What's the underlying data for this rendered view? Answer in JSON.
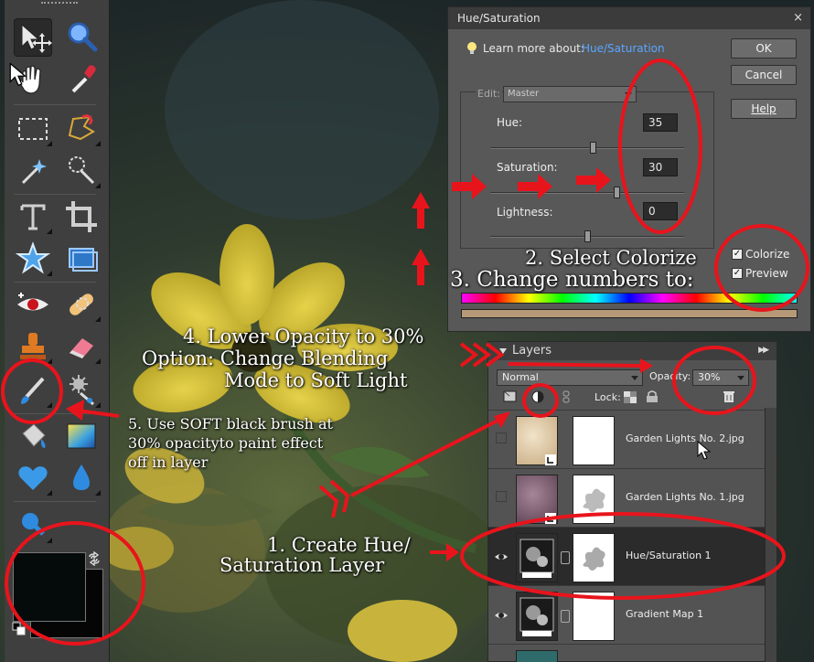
{
  "colors": {
    "annotation_red": "#e8141c",
    "link_blue": "#5aa6ff",
    "panel_gray": "#585858"
  },
  "toolbox": {
    "tools": [
      {
        "name": "move-tool",
        "icon": "move-icon",
        "active": true
      },
      {
        "name": "zoom-tool",
        "icon": "magnifier-icon"
      },
      {
        "name": "hand-tool",
        "icon": "hand-icon"
      },
      {
        "name": "eyedropper-tool",
        "icon": "eyedropper-icon"
      },
      {
        "name": "marquee-tool",
        "icon": "rect-marquee-icon"
      },
      {
        "name": "lasso-tool",
        "icon": "magnetic-lasso-icon"
      },
      {
        "name": "magic-wand-tool",
        "icon": "magic-wand-icon"
      },
      {
        "name": "quick-selection-tool",
        "icon": "quick-selection-icon"
      },
      {
        "name": "type-tool",
        "icon": "type-icon"
      },
      {
        "name": "crop-tool",
        "icon": "crop-icon"
      },
      {
        "name": "cookie-cutter-tool",
        "icon": "star-shape-icon"
      },
      {
        "name": "straighten-tool",
        "icon": "straighten-icon"
      },
      {
        "name": "red-eye-tool",
        "icon": "eye-icon"
      },
      {
        "name": "healing-brush-tool",
        "icon": "bandage-icon"
      },
      {
        "name": "clone-stamp-tool",
        "icon": "stamp-icon"
      },
      {
        "name": "eraser-tool",
        "icon": "eraser-icon"
      },
      {
        "name": "brush-tool",
        "icon": "brush-icon"
      },
      {
        "name": "smart-brush-tool",
        "icon": "smart-brush-icon"
      },
      {
        "name": "paint-bucket-tool",
        "icon": "bucket-icon"
      },
      {
        "name": "gradient-tool",
        "icon": "gradient-icon"
      },
      {
        "name": "custom-shape-tool",
        "icon": "heart-icon"
      },
      {
        "name": "blur-tool",
        "icon": "drop-icon"
      },
      {
        "name": "sponge-tool",
        "icon": "sponge-icon"
      }
    ]
  },
  "hue_saturation": {
    "title": "Hue/Saturation",
    "close_glyph": "×",
    "learn_more": "Learn more about:",
    "learn_link": "Hue/Saturation",
    "ok": "OK",
    "cancel": "Cancel",
    "help": "Help",
    "edit_label": "Edit:",
    "edit_value": "Master",
    "hue_label": "Hue:",
    "hue_value": "35",
    "saturation_label": "Saturation:",
    "saturation_value": "30",
    "lightness_label": "Lightness:",
    "lightness_value": "0",
    "hue_slider": 0.53,
    "saturation_slider": 0.65,
    "lightness_slider": 0.5,
    "colorize_label": "Colorize",
    "colorize_checked": "✓",
    "preview_label": "Preview",
    "preview_checked": "✓"
  },
  "layers": {
    "title": "Layers",
    "expand_glyph": "▶▶",
    "blend_mode": "Normal",
    "opacity_label": "Opacity:",
    "opacity_value": "30%",
    "lock_label": "Lock:",
    "rows": [
      {
        "name": "Garden Lights No. 2.jpg",
        "visible": false,
        "thumb": "#d7c3a2"
      },
      {
        "name": "Garden Lights No. 1.jpg",
        "visible": false,
        "thumb": "#7a5a6c"
      },
      {
        "name": "Hue/Saturation 1",
        "visible": true,
        "selected": true,
        "thumb": "adjustment"
      },
      {
        "name": "Gradient Map 1",
        "visible": true,
        "thumb": "adjustment"
      }
    ]
  },
  "annotations": {
    "step1_line1": "1. Create Hue/",
    "step1_line2": "Saturation Layer",
    "step2": "2. Select Colorize",
    "step3": "3. Change numbers to:",
    "step4_line1": "4. Lower Opacity to 30%",
    "step4_line2": "Option: Change Blending",
    "step4_line3": "Mode to Soft Light",
    "step5_line1": "5. Use SOFT black brush at",
    "step5_line2": "30% opacityto paint effect",
    "step5_line3": "off in layer"
  }
}
